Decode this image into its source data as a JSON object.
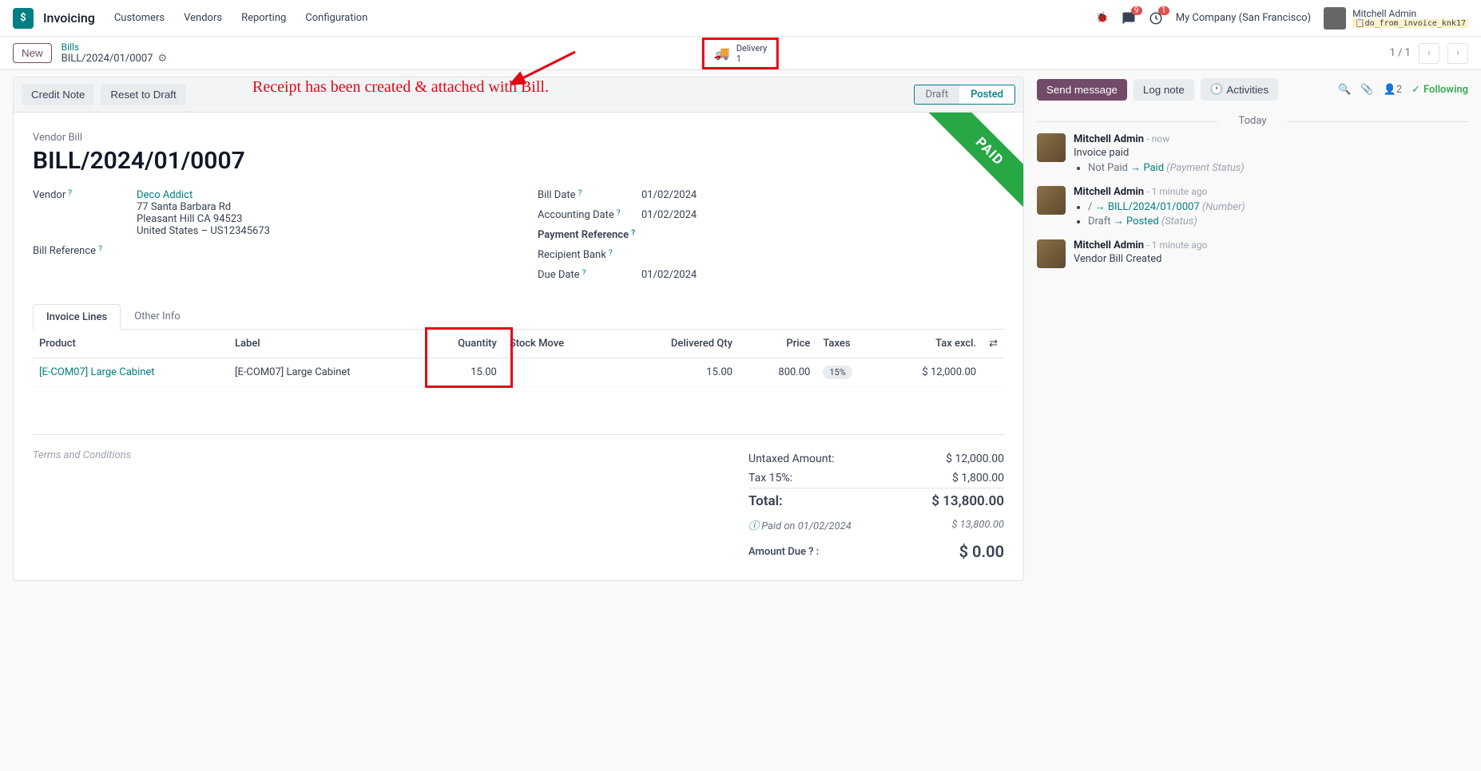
{
  "topnav": {
    "brand": "Invoicing",
    "menu": [
      "Customers",
      "Vendors",
      "Reporting",
      "Configuration"
    ],
    "msg_badge": "9",
    "act_badge": "1",
    "company": "My Company (San Francisco)",
    "user_name": "Mitchell Admin",
    "user_db": "do_from_invoice_knk17"
  },
  "breadcrumb": {
    "new_label": "New",
    "parent": "Bills",
    "current": "BILL/2024/01/0007",
    "delivery_label": "Delivery",
    "delivery_count": "1",
    "pager": "1 / 1"
  },
  "annotation": "Receipt has been created & attached with Bill.",
  "statusbar": {
    "credit_note": "Credit Note",
    "reset_draft": "Reset to Draft",
    "draft": "Draft",
    "posted": "Posted"
  },
  "bill": {
    "subtitle": "Vendor Bill",
    "name": "BILL/2024/01/0007",
    "paid_label": "PAID",
    "vendor_label": "Vendor",
    "vendor_name": "Deco Addict",
    "vendor_addr1": "77 Santa Barbara Rd",
    "vendor_addr2": "Pleasant Hill CA 94523",
    "vendor_addr3": "United States – US12345673",
    "bill_ref_label": "Bill Reference",
    "bill_date_label": "Bill Date",
    "bill_date": "01/02/2024",
    "acc_date_label": "Accounting Date",
    "acc_date": "01/02/2024",
    "pay_ref_label": "Payment Reference",
    "recip_bank_label": "Recipient Bank",
    "due_date_label": "Due Date",
    "due_date": "01/02/2024"
  },
  "tabs": {
    "lines": "Invoice Lines",
    "other": "Other Info"
  },
  "table": {
    "h_product": "Product",
    "h_label": "Label",
    "h_qty": "Quantity",
    "h_stock": "Stock Move",
    "h_del": "Delivered Qty",
    "h_price": "Price",
    "h_taxes": "Taxes",
    "h_excl": "Tax excl.",
    "rows": [
      {
        "product": "[E-COM07] Large Cabinet",
        "label": "[E-COM07] Large Cabinet",
        "qty": "15.00",
        "del": "15.00",
        "price": "800.00",
        "tax": "15%",
        "excl": "$ 12,000.00"
      }
    ]
  },
  "terms_placeholder": "Terms and Conditions",
  "totals": {
    "untaxed_l": "Untaxed Amount:",
    "untaxed_v": "$ 12,000.00",
    "tax_l": "Tax 15%:",
    "tax_v": "$ 1,800.00",
    "total_l": "Total:",
    "total_v": "$ 13,800.00",
    "paid_on_l": "Paid on 01/02/2024",
    "paid_on_v": "$ 13,800.00",
    "due_l": "Amount Due",
    "due_suffix": ":",
    "due_v": "$ 0.00"
  },
  "chatter": {
    "send": "Send message",
    "log": "Log note",
    "activities": "Activities",
    "follower_count": "2",
    "following": "Following",
    "today": "Today",
    "msgs": [
      {
        "author": "Mitchell Admin",
        "time": "now",
        "title": "Invoice paid",
        "items": [
          {
            "old": "Not Paid",
            "new": "Paid",
            "field": "(Payment Status)"
          }
        ]
      },
      {
        "author": "Mitchell Admin",
        "time": "1 minute ago",
        "items": [
          {
            "old": "/",
            "new": "BILL/2024/01/0007",
            "field": "(Number)"
          },
          {
            "old": "Draft",
            "new": "Posted",
            "field": "(Status)"
          }
        ]
      },
      {
        "author": "Mitchell Admin",
        "time": "1 minute ago",
        "text": "Vendor Bill Created"
      }
    ]
  }
}
